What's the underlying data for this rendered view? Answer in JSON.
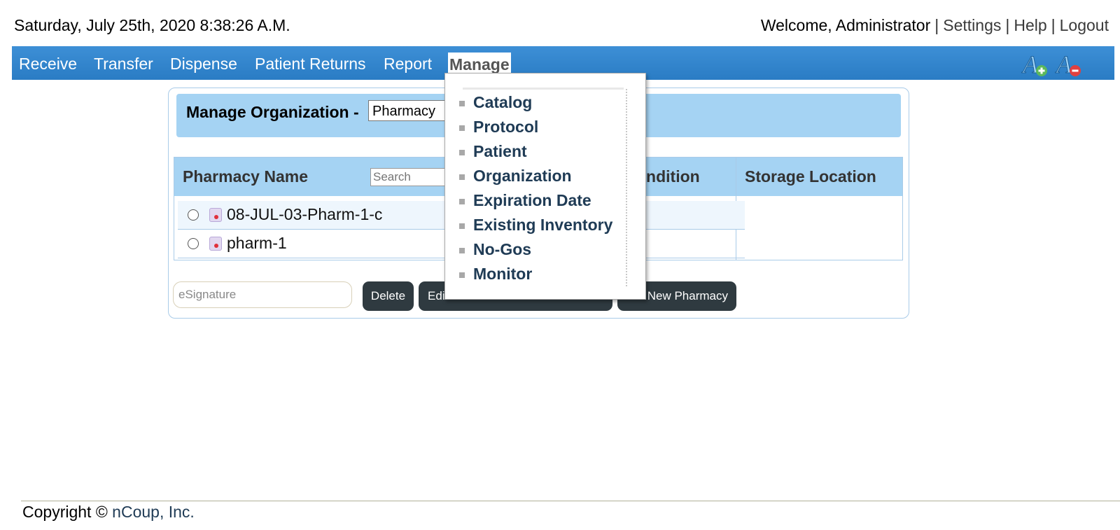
{
  "header": {
    "datetime": "Saturday, July 25th, 2020 8:38:26 A.M.",
    "welcome": "Welcome, Administrator",
    "separator": "|",
    "settings": "Settings",
    "help": "Help",
    "logout": "Logout"
  },
  "nav": {
    "items": [
      "Receive",
      "Transfer",
      "Dispense",
      "Patient Returns",
      "Report",
      "Manage"
    ],
    "active": "Manage",
    "font_increase_icon": "font-increase-icon",
    "font_decrease_icon": "font-decrease-icon"
  },
  "manage_menu": {
    "items": [
      "Catalog",
      "Protocol",
      "Patient",
      "Organization",
      "Expiration Date",
      "Existing Inventory",
      "No-Gos",
      "Monitor"
    ]
  },
  "panel": {
    "title": "Manage Organization -",
    "org_type_selected": "Pharmacy",
    "columns": [
      "Pharmacy Name",
      "ondition",
      "Storage Location"
    ],
    "search_placeholder": "Search",
    "rows": [
      {
        "name": "08-JUL-03-Pharm-1-c"
      },
      {
        "name": "pharm-1"
      }
    ],
    "esignature_placeholder": "eSignature",
    "buttons": {
      "delete": "Delete",
      "edit": "Edi",
      "new": "New Pharmacy"
    }
  },
  "footer": {
    "copyright": "Copyright ©",
    "company": "nCoup, Inc."
  },
  "colors": {
    "nav_bar": "#2f84cc",
    "panel_header": "#a5d3f3",
    "button": "#2f3a40",
    "menu_text": "#1f3b55"
  }
}
